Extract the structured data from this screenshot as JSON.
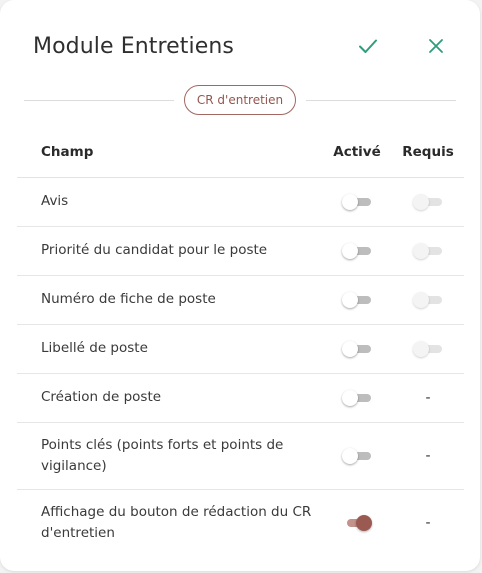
{
  "dialog": {
    "title": "Module Entretiens",
    "confirm_icon": "check-icon",
    "close_icon": "close-icon",
    "accent_color": "#2e9c7d"
  },
  "section": {
    "label": "CR d'entretien",
    "color": "#93564f"
  },
  "table": {
    "headers": {
      "field": "Champ",
      "active": "Activé",
      "required": "Requis"
    },
    "rows": [
      {
        "label": "Avis",
        "active": false,
        "required": "toggle-off-disabled"
      },
      {
        "label": "Priorité du candidat pour le poste",
        "active": false,
        "required": "toggle-off-disabled"
      },
      {
        "label": "Numéro de fiche de poste",
        "active": false,
        "required": "toggle-off-disabled"
      },
      {
        "label": "Libellé de poste",
        "active": false,
        "required": "toggle-off-disabled"
      },
      {
        "label": "Création de poste",
        "active": false,
        "required": "-"
      },
      {
        "label": "Points clés (points forts et points de vigilance)",
        "active": false,
        "required": "-"
      },
      {
        "label": "Affichage du bouton de rédaction du CR d'entretien",
        "active": true,
        "required": "-"
      }
    ]
  }
}
